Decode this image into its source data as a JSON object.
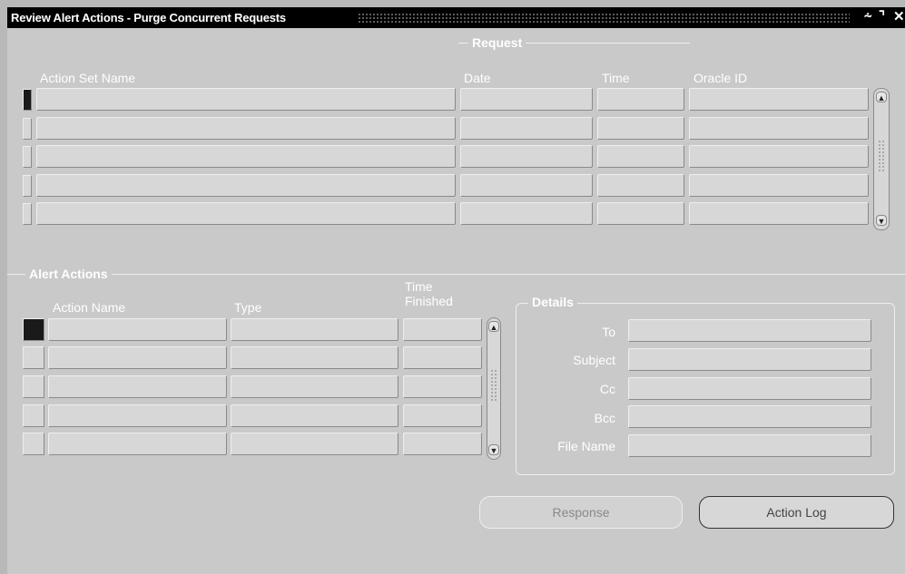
{
  "window": {
    "title": "Review Alert Actions - Purge Concurrent Requests",
    "controls": [
      "⸞",
      "⌝",
      "✕"
    ]
  },
  "request": {
    "section_title": "Request",
    "columns": {
      "action_set_name": "Action Set Name",
      "date": "Date",
      "time": "Time",
      "oracle_id": "Oracle ID"
    },
    "rows": [
      {
        "action_set_name": "",
        "date": "",
        "time": "",
        "oracle_id": ""
      },
      {
        "action_set_name": "",
        "date": "",
        "time": "",
        "oracle_id": ""
      },
      {
        "action_set_name": "",
        "date": "",
        "time": "",
        "oracle_id": ""
      },
      {
        "action_set_name": "",
        "date": "",
        "time": "",
        "oracle_id": ""
      },
      {
        "action_set_name": "",
        "date": "",
        "time": "",
        "oracle_id": ""
      }
    ]
  },
  "alert_actions": {
    "section_title": "Alert Actions",
    "columns": {
      "action_name": "Action Name",
      "type": "Type",
      "time_finished_1": "Time",
      "time_finished_2": "Finished"
    },
    "rows": [
      {
        "action_name": "",
        "type": "",
        "time_finished": ""
      },
      {
        "action_name": "",
        "type": "",
        "time_finished": ""
      },
      {
        "action_name": "",
        "type": "",
        "time_finished": ""
      },
      {
        "action_name": "",
        "type": "",
        "time_finished": ""
      },
      {
        "action_name": "",
        "type": "",
        "time_finished": ""
      }
    ]
  },
  "details": {
    "group_title": "Details",
    "fields": {
      "to": "To",
      "subject": "Subject",
      "cc": "Cc",
      "bcc": "Bcc",
      "file_name": "File Name"
    },
    "values": {
      "to": "",
      "subject": "",
      "cc": "",
      "bcc": "",
      "file_name": ""
    }
  },
  "buttons": {
    "response": "Response",
    "action_log": "Action Log"
  },
  "icons": {
    "scroll_up": "scroll-up-arrow-icon",
    "scroll_down": "scroll-down-arrow-icon"
  }
}
